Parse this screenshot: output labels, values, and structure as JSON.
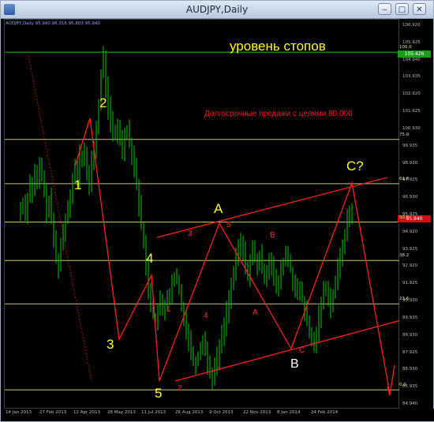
{
  "window": {
    "title": "AUDJPY,Daily",
    "buttons": {
      "minimize": "‒",
      "maximize": "□",
      "close": "✕"
    }
  },
  "chart_header": "AUDJPY,Daily  95.940 96.316 95.803 95.940",
  "annotations": {
    "stops_level": "уровень стопов",
    "long_term_note": "Долгосрочные продажи с целями 80.000"
  },
  "wave_labels": {
    "yellow": [
      "1",
      "2",
      "3",
      "4",
      "5",
      "A",
      "C?"
    ],
    "white": [
      "B"
    ],
    "red": [
      "1",
      "2",
      "3",
      "4",
      "5",
      "A",
      "B",
      "C"
    ]
  },
  "price_boxes": {
    "top": "105.426",
    "current": "95.940"
  },
  "colors": {
    "background": "#000000",
    "candles": "#00c800",
    "fib_lines": "#c8c864",
    "top_line": "#00c800",
    "trend_lines": "#ff2020",
    "labels_yellow": "#ffff33",
    "labels_red": "#ff2a2a",
    "price_box_red": "#d01010",
    "price_box_green": "#16a016"
  },
  "chart_data": {
    "type": "candlestick",
    "symbol": "AUDJPY",
    "timeframe": "Daily",
    "ylim": [
      84.5,
      106.9
    ],
    "y_ticks": [
      "106.920",
      "105.925",
      "104.940",
      "103.935",
      "102.920",
      "101.925",
      "100.930",
      "99.935",
      "98.930",
      "97.925",
      "96.930",
      "95.925",
      "94.920",
      "93.925",
      "92.920",
      "91.925",
      "90.930",
      "89.935",
      "88.930",
      "87.925",
      "86.930",
      "85.935",
      "84.940"
    ],
    "x_ticks": [
      "14 Jan 2013",
      "27 Feb 2013",
      "12 Apr 2013",
      "28 May 2013",
      "11 Jul 2013",
      "26 Aug 2013",
      "9 Oct 2013",
      "22 Nov 2013",
      "8 Jan 2014",
      "24 Feb 2014"
    ],
    "fib_levels": [
      {
        "label": "100.0",
        "price": 105.43
      },
      {
        "label": "75.0",
        "price": 100.2
      },
      {
        "label": "61.8",
        "price": 97.55
      },
      {
        "label": "50.0",
        "price": 95.25
      },
      {
        "label": "38.2",
        "price": 92.95
      },
      {
        "label": "23.6",
        "price": 90.35
      },
      {
        "label": "0.0",
        "price": 85.2
      }
    ],
    "close_series": [
      96.0,
      96.5,
      95.8,
      96.8,
      97.6,
      97.0,
      98.2,
      97.5,
      98.6,
      98.1,
      96.9,
      95.9,
      96.6,
      95.4,
      94.2,
      93.1,
      92.6,
      93.9,
      94.7,
      95.5,
      96.2,
      97.0,
      97.9,
      98.6,
      97.8,
      99.3,
      98.8,
      99.6,
      98.1,
      97.4,
      98.8,
      99.7,
      100.9,
      102.2,
      104.1,
      105.2,
      103.3,
      102.1,
      101.3,
      100.6,
      100.3,
      101.1,
      100.2,
      99.6,
      100.6,
      100.9,
      100.1,
      99.4,
      98.6,
      97.6,
      96.2,
      95.1,
      93.9,
      92.6,
      91.3,
      90.5,
      89.6,
      89.4,
      89.9,
      90.5,
      89.8,
      90.3,
      91.0,
      90.6,
      91.5,
      92.0,
      91.7,
      91.1,
      90.3,
      89.6,
      88.8,
      88.2,
      87.5,
      87.0,
      86.8,
      87.3,
      87.8,
      88.3,
      87.6,
      86.8,
      86.3,
      85.9,
      86.6,
      87.1,
      87.8,
      88.4,
      89.1,
      89.9,
      90.7,
      91.4,
      92.2,
      93.0,
      93.7,
      94.0,
      93.4,
      92.7,
      92.1,
      92.9,
      93.6,
      93.1,
      92.5,
      93.2,
      92.6,
      91.9,
      92.4,
      93.1,
      92.7,
      91.8,
      91.2,
      91.7,
      92.3,
      92.9,
      93.4,
      93.0,
      92.4,
      91.7,
      91.2,
      90.8,
      91.3,
      90.6,
      89.9,
      89.2,
      88.6,
      88.1,
      87.9,
      88.7,
      89.6,
      90.4,
      91.1,
      91.5,
      90.8,
      90.2,
      90.9,
      91.7,
      92.4,
      93.1,
      93.9,
      94.6,
      95.3,
      95.9,
      95.6
    ]
  }
}
